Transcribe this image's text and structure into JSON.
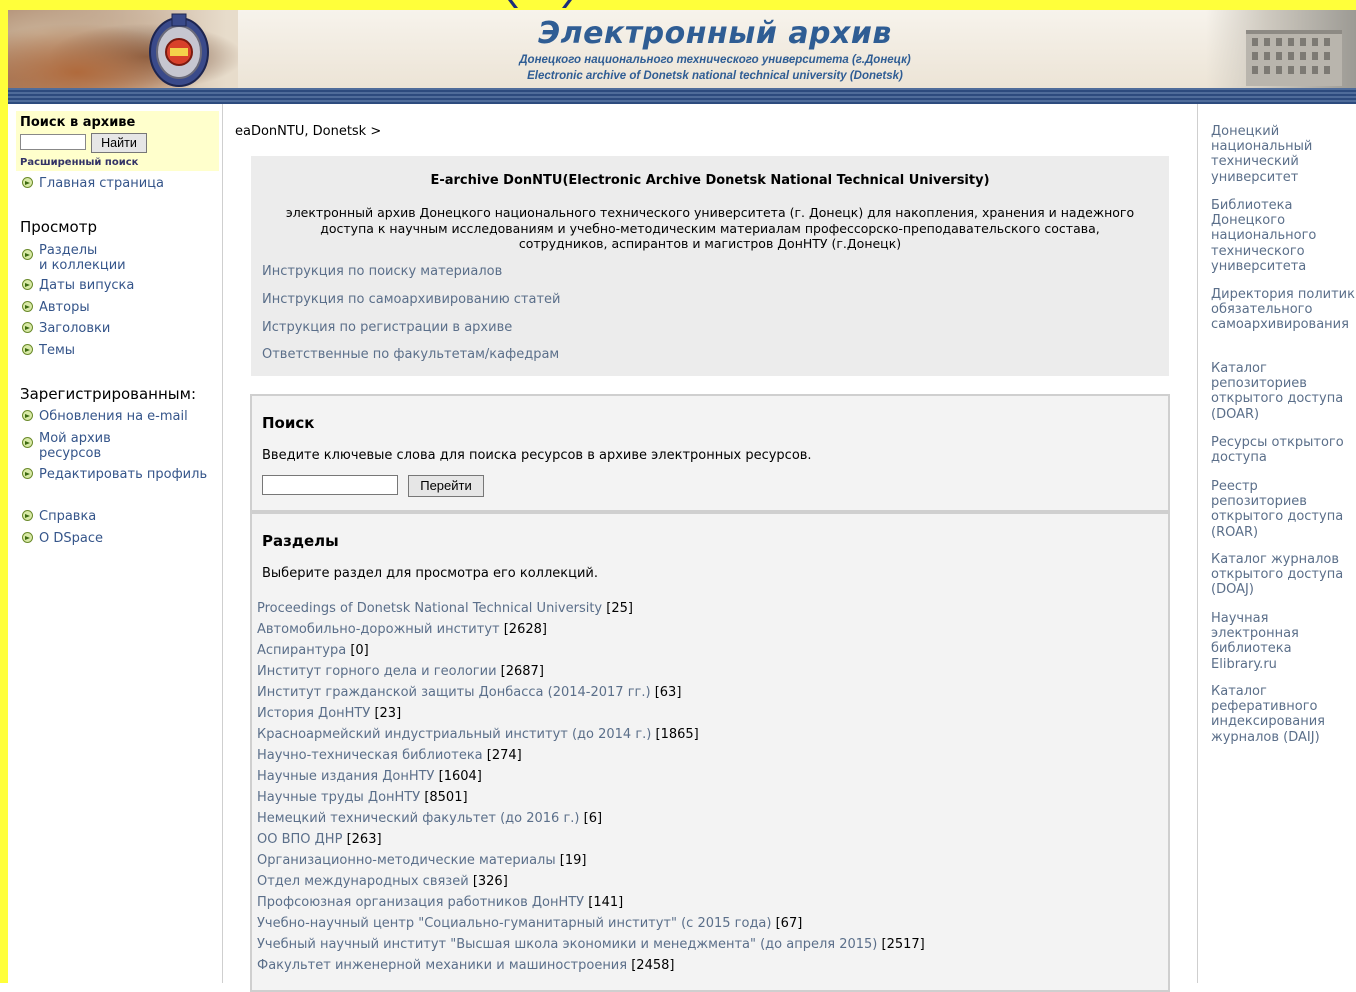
{
  "banner": {
    "title": "Электронный архив",
    "subtitle_ru": "Донецкого национального технического университета (г.Донецк)",
    "subtitle_en": "Electronic archive of Donetsk national technical university (Donetsk)"
  },
  "sidebar": {
    "search_title": "Поиск в архиве",
    "search_button": "Найти",
    "advanced_search": "Расширенный поиск",
    "home": "Главная страница",
    "browse_heading": "Просмотр",
    "browse_items": [
      "Разделы",
      "и коллекции",
      "Даты випуска",
      "Авторы",
      "Заголовки",
      "Темы"
    ],
    "registered_heading": "Зарегистрированным:",
    "registered_items": [
      "Обновления на e-mail",
      "Мой архив",
      "ресурсов",
      "Редактировать профиль"
    ],
    "help": "Справка",
    "about": "О DSpace"
  },
  "main": {
    "breadcrumb": "eaDonNTU, Donetsk >",
    "intro_title": "E-archive DonNTU(Electronic Archive Donetsk National Technical University)",
    "intro_desc": "электронный архив Донецкого национального технического университета (г. Донецк) для накопления, хранения и надежного доступа к научным исследованиям и учебно-методическим материалам профессорско-преподавательского состава, сотрудников, аспирантов и магистров ДонНТУ (г.Донецк)",
    "intro_links": [
      "Инструкция по поиску материалов",
      "Инструкция по самоархивированию статей",
      "Иструкция по регистрации в архиве",
      "Ответственные по факультетам/кафедрам"
    ],
    "search_heading": "Поиск",
    "search_text": "Введите ключевые слова для поиска ресурсов в архиве электронных ресурсов.",
    "search_button": "Перейти",
    "sections_heading": "Разделы",
    "sections_text": "Выберите раздел для просмотра его коллекций.",
    "communities": [
      {
        "name": "Proceedings of Donetsk National Technical University",
        "count": "[25]"
      },
      {
        "name": "Автомобильно-дорожный институт",
        "count": "[2628]"
      },
      {
        "name": "Аспирантура",
        "count": "[0]"
      },
      {
        "name": "Институт горного дела и геологии",
        "count": "[2687]"
      },
      {
        "name": "Институт гражданской защиты Донбасса (2014-2017 гг.)",
        "count": "[63]"
      },
      {
        "name": "История ДонНТУ",
        "count": "[23]"
      },
      {
        "name": "Красноармейский индустриальный институт (до 2014 г.)",
        "count": "[1865]"
      },
      {
        "name": "Научно-техническая библиотека",
        "count": "[274]"
      },
      {
        "name": "Научные издания ДонНТУ",
        "count": "[1604]"
      },
      {
        "name": "Научные труды ДонНТУ",
        "count": "[8501]"
      },
      {
        "name": "Немецкий технический факультет (до 2016 г.)",
        "count": "[6]"
      },
      {
        "name": "ОО ВПО ДНР",
        "count": "[263]"
      },
      {
        "name": "Организационно-методические материалы",
        "count": "[19]"
      },
      {
        "name": "Отдел международных связей",
        "count": "[326]"
      },
      {
        "name": "Профсоюзная организация работников ДонНТУ",
        "count": "[141]"
      },
      {
        "name": "Учебно-научный центр \"Социально-гуманитарный институт\" (с 2015 года)",
        "count": "[67]"
      },
      {
        "name": "Учебный научный институт \"Высшая школа экономики и менеджмента\" (до апреля 2015)",
        "count": "[2517]"
      },
      {
        "name": "Факультет инженерной механики и машиностроения",
        "count": "[2458]"
      }
    ]
  },
  "right_links": [
    "Донецкий национальный технический университет",
    "Библиотека Донецкого национального технического университета",
    "Директория политик обязательного самоархивирования",
    "Каталог репозиториев открытого доступа (DOAR)",
    "Ресурсы открытого доступа",
    "Реестр репозиториев открытого доступа (ROAR)",
    "Каталог журналов открытого доступа (DOAJ)",
    "Научная электронная библиотека Elibrary.ru",
    "Каталог реферативного индексирования журналов (DAIJ)"
  ]
}
